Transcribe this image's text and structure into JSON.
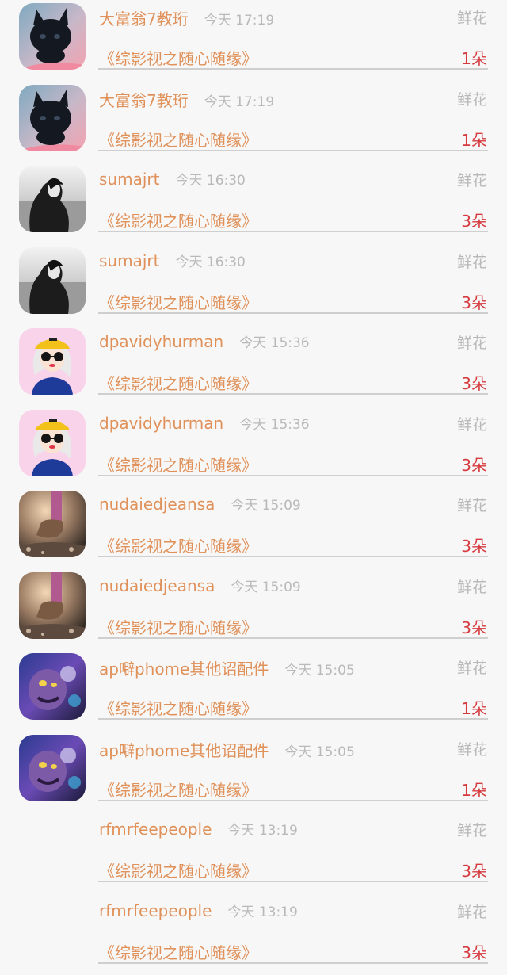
{
  "records": [
    {
      "user": "大富翁7教珩",
      "time": "今天 17:19",
      "gift": "鲜花",
      "book": "《综影视之随心随缘》",
      "count": "1朵",
      "avatar": "cat-avatar"
    },
    {
      "user": "大富翁7教珩",
      "time": "今天 17:19",
      "gift": "鲜花",
      "book": "《综影视之随心随缘》",
      "count": "1朵",
      "avatar": "cat-avatar"
    },
    {
      "user": "sumajrt",
      "time": "今天 16:30",
      "gift": "鲜花",
      "book": "《综影视之随心随缘》",
      "count": "3朵",
      "avatar": "bw-portrait-avatar"
    },
    {
      "user": "sumajrt",
      "time": "今天 16:30",
      "gift": "鲜花",
      "book": "《综影视之随心随缘》",
      "count": "3朵",
      "avatar": "bw-portrait-avatar"
    },
    {
      "user": "dpavidyhurman",
      "time": "今天 15:36",
      "gift": "鲜花",
      "book": "《综影视之随心随缘》",
      "count": "3朵",
      "avatar": "cartoon-girl-avatar"
    },
    {
      "user": "dpavidyhurman",
      "time": "今天 15:36",
      "gift": "鲜花",
      "book": "《综影视之随心随缘》",
      "count": "3朵",
      "avatar": "cartoon-girl-avatar"
    },
    {
      "user": "nudaiedjeansa",
      "time": "今天 15:09",
      "gift": "鲜花",
      "book": "《综影视之随心随缘》",
      "count": "3朵",
      "avatar": "shoe-photo-avatar"
    },
    {
      "user": "nudaiedjeansa",
      "time": "今天 15:09",
      "gift": "鲜花",
      "book": "《综影视之随心随缘》",
      "count": "3朵",
      "avatar": "shoe-photo-avatar"
    },
    {
      "user": "ap噼phome其他诏配件",
      "time": "今天 15:05",
      "gift": "鲜花",
      "book": "《综影视之随心随缘》",
      "count": "1朵",
      "avatar": "game-character-avatar"
    },
    {
      "user": "ap噼phome其他诏配件",
      "time": "今天 15:05",
      "gift": "鲜花",
      "book": "《综影视之随心随缘》",
      "count": "1朵",
      "avatar": "game-character-avatar"
    },
    {
      "user": "rfmrfeepeople",
      "time": "今天 13:19",
      "gift": "鲜花",
      "book": "《综影视之随心随缘》",
      "count": "3朵",
      "avatar": "none"
    },
    {
      "user": "rfmrfeepeople",
      "time": "今天 13:19",
      "gift": "鲜花",
      "book": "《综影视之随心随缘》",
      "count": "3朵",
      "avatar": "none"
    }
  ],
  "colors": {
    "name": "#e0915a",
    "time": "#b9b9b9",
    "count": "#d63a3e",
    "divider": "#cfcfcf",
    "background": "#f7f7f7"
  }
}
